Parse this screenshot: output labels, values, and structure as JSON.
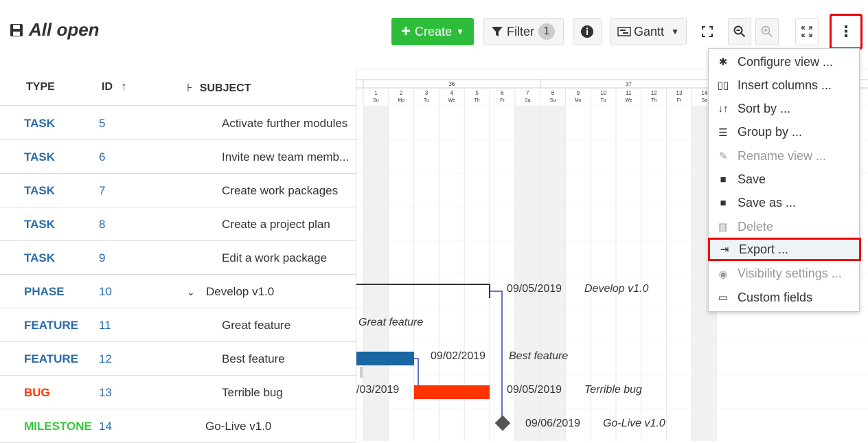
{
  "header": {
    "title": "All open",
    "create_label": "Create",
    "filter_label": "Filter",
    "filter_count": "1",
    "view_mode_label": "Gantt"
  },
  "table": {
    "columns": {
      "type": "TYPE",
      "id": "ID",
      "subject": "SUBJECT"
    },
    "rows": [
      {
        "type": "TASK",
        "id": "5",
        "subject": "Activate further modules"
      },
      {
        "type": "TASK",
        "id": "6",
        "subject": "Invite new team memb..."
      },
      {
        "type": "TASK",
        "id": "7",
        "subject": "Create work packages"
      },
      {
        "type": "TASK",
        "id": "8",
        "subject": "Create a project plan"
      },
      {
        "type": "TASK",
        "id": "9",
        "subject": "Edit a work package"
      },
      {
        "type": "PHASE",
        "id": "10",
        "subject": "Develop v1.0"
      },
      {
        "type": "FEATURE",
        "id": "11",
        "subject": "Great feature"
      },
      {
        "type": "FEATURE",
        "id": "12",
        "subject": "Best feature"
      },
      {
        "type": "BUG",
        "id": "13",
        "subject": "Terrible bug"
      },
      {
        "type": "MILESTONE",
        "id": "14",
        "subject": "Go-Live v1.0"
      }
    ]
  },
  "type_colors": {
    "TASK": "#2a6ca8",
    "PHASE": "#2a6ca8",
    "FEATURE": "#2a6ca8",
    "BUG": "#ff3300",
    "MILESTONE": "#35c53f"
  },
  "gantt": {
    "weeks": [
      "36",
      "37"
    ],
    "days": [
      {
        "num": "1",
        "name": "Su"
      },
      {
        "num": "2",
        "name": "Mo"
      },
      {
        "num": "3",
        "name": "Tu"
      },
      {
        "num": "4",
        "name": "We"
      },
      {
        "num": "5",
        "name": "Th"
      },
      {
        "num": "6",
        "name": "Fr"
      },
      {
        "num": "7",
        "name": "Sa"
      },
      {
        "num": "8",
        "name": "Su"
      },
      {
        "num": "9",
        "name": "Mo"
      },
      {
        "num": "10",
        "name": "Tu"
      },
      {
        "num": "11",
        "name": "We"
      },
      {
        "num": "12",
        "name": "Th"
      },
      {
        "num": "13",
        "name": "Fr"
      },
      {
        "num": "14",
        "name": "Sa"
      }
    ],
    "labels": {
      "phase_date": "09/05/2019",
      "phase_name": "Develop v1.0",
      "great_feature": "Great feature",
      "best_date": "09/02/2019",
      "best_name": "Best feature",
      "bug_start": "/03/2019",
      "bug_date": "09/05/2019",
      "bug_name": "Terrible bug",
      "milestone_date": "09/06/2019",
      "milestone_name": "Go-Live v1.0"
    },
    "bar_colors": {
      "feature": "#1a67a3",
      "bug": "#ff3300",
      "milestone": "#555555"
    }
  },
  "menu": {
    "items": [
      {
        "label": "Configure view ...",
        "icon": "gear-icon",
        "disabled": false
      },
      {
        "label": "Insert columns ...",
        "icon": "columns-icon",
        "disabled": false
      },
      {
        "label": "Sort by ...",
        "icon": "sort-icon",
        "disabled": false
      },
      {
        "label": "Group by ...",
        "icon": "group-icon",
        "disabled": false
      },
      {
        "label": "Rename view ...",
        "icon": "pencil-icon",
        "disabled": true
      },
      {
        "label": "Save",
        "icon": "save-icon",
        "disabled": false
      },
      {
        "label": "Save as ...",
        "icon": "save-icon",
        "disabled": false
      },
      {
        "label": "Delete",
        "icon": "trash-icon",
        "disabled": true
      },
      {
        "label": "Export ...",
        "icon": "export-icon",
        "disabled": false,
        "highlighted": true
      },
      {
        "label": "Visibility settings ...",
        "icon": "eye-icon",
        "disabled": true
      },
      {
        "label": "Custom fields",
        "icon": "custom-field-icon",
        "disabled": false
      }
    ]
  }
}
